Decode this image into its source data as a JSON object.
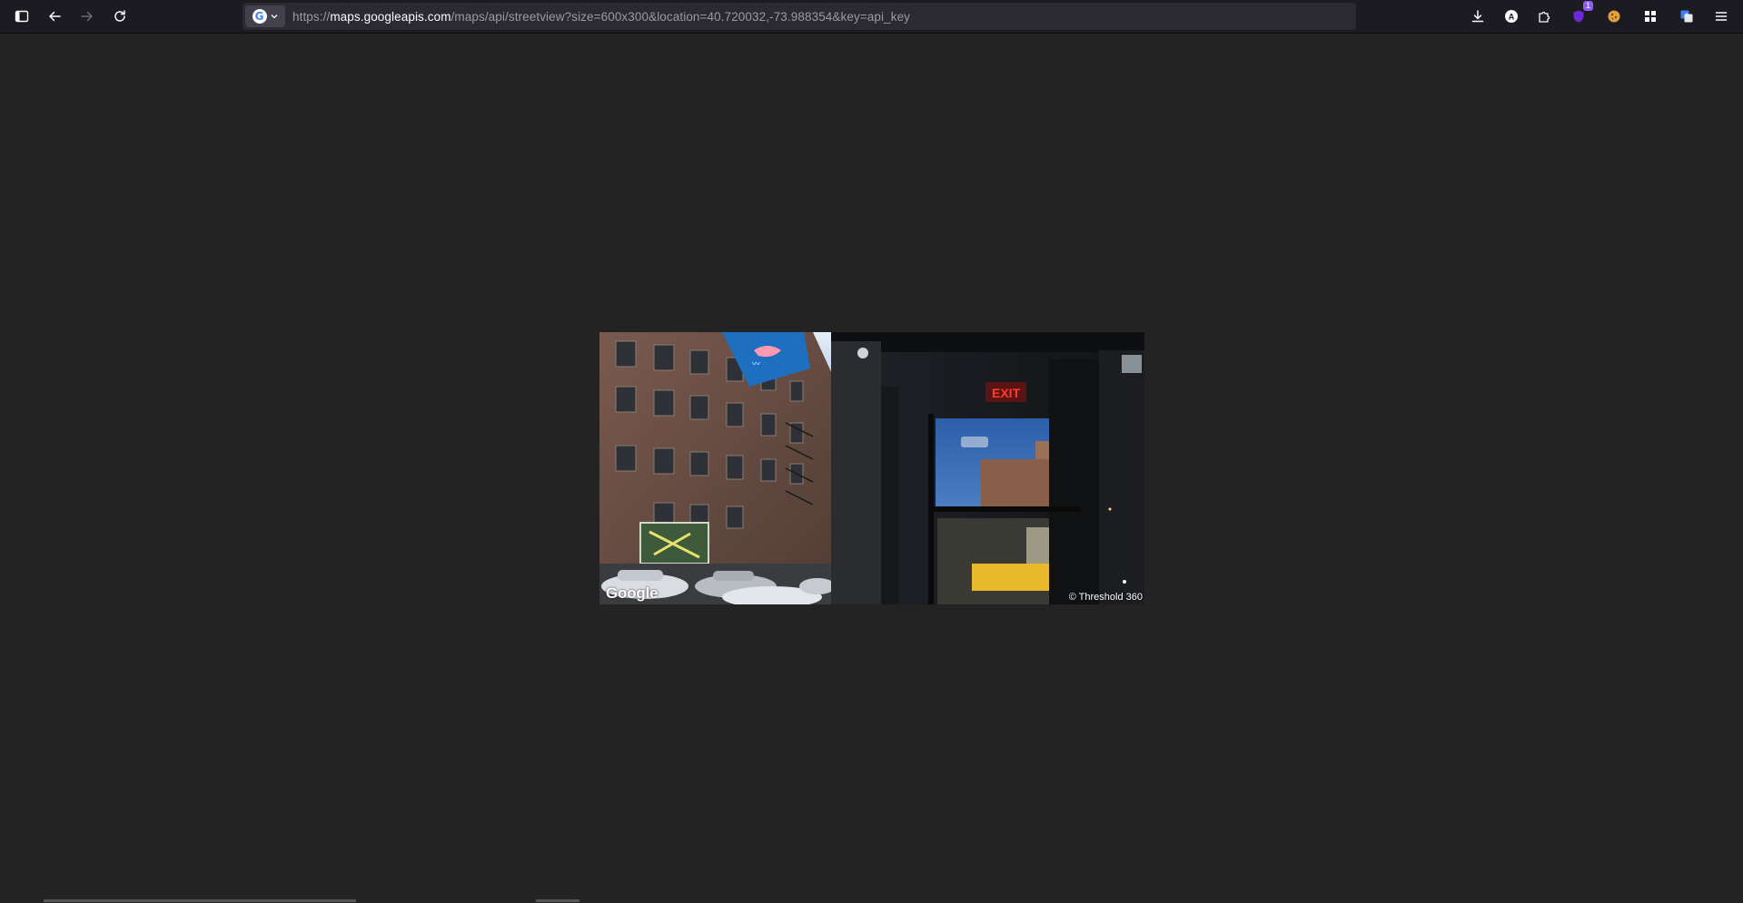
{
  "browser": {
    "url_prefix": "https://",
    "url_host": "maps.googleapis.com",
    "url_path": "/maps/api/streetview?size=600x300&location=40.720032,-73.988354&key=api_key",
    "search_engine_icon": "google-g-icon",
    "extension_badge_count": "1"
  },
  "toolbar_icons": {
    "sidebar": "sidebar-icon",
    "back": "back-arrow-icon",
    "forward": "forward-arrow-icon",
    "reload": "reload-icon",
    "downloads": "download-icon",
    "account": "account-icon",
    "extensions": "puzzle-icon",
    "menu": "hamburger-menu-icon"
  },
  "image": {
    "watermark": "Google",
    "copyright": "© Threshold 360"
  },
  "colors": {
    "page_background": "#232323",
    "toolbar_background": "#1c1b22",
    "urlbar_background": "#2b2a33"
  }
}
